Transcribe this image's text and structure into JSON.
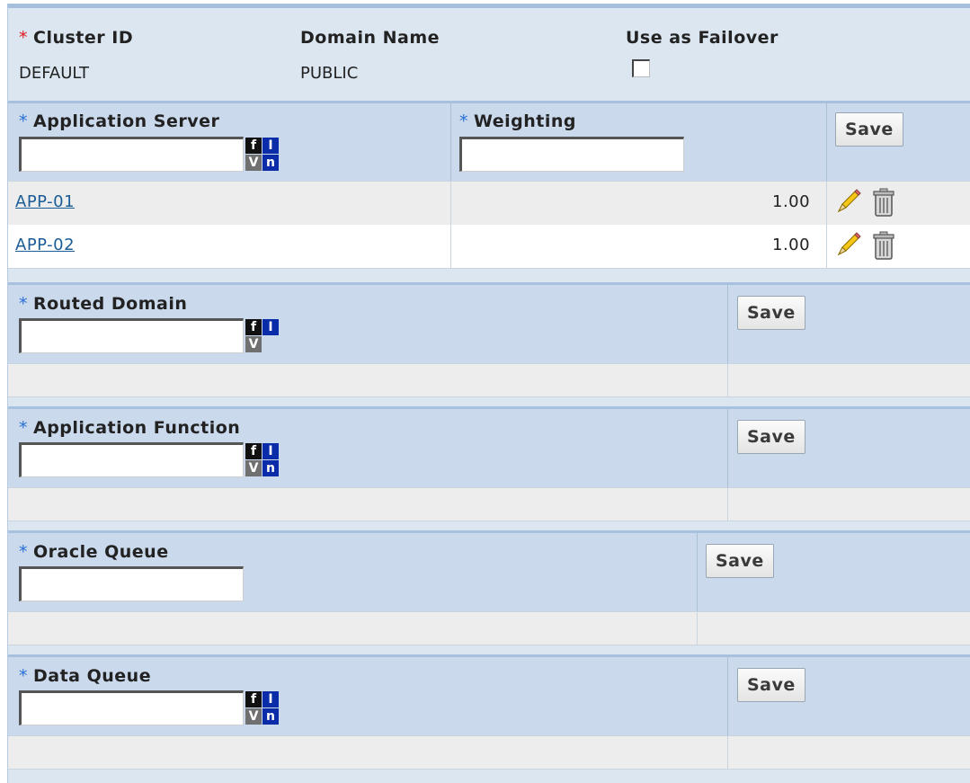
{
  "header": {
    "cluster_id_label": "Cluster ID",
    "cluster_id_value": "DEFAULT",
    "domain_name_label": "Domain Name",
    "domain_name_value": "PUBLIC",
    "failover_label": "Use as Failover",
    "failover_checked": false
  },
  "required_marker": "*",
  "save_label": "Save",
  "prompt_icons": {
    "f": "f",
    "i": "I",
    "v": "V",
    "n": "n"
  },
  "app_server": {
    "label": "Application Server",
    "input_value": "",
    "weighting_label": "Weighting",
    "weighting_value": "",
    "rows": [
      {
        "server": "APP-01",
        "weighting": "1.00"
      },
      {
        "server": "APP-02",
        "weighting": "1.00"
      }
    ]
  },
  "routed_domain": {
    "label": "Routed Domain",
    "input_value": ""
  },
  "app_function": {
    "label": "Application Function",
    "input_value": ""
  },
  "oracle_queue": {
    "label": "Oracle Queue",
    "input_value": ""
  },
  "data_queue": {
    "label": "Data Queue",
    "input_value": ""
  },
  "icons": {
    "edit": "pencil-icon",
    "delete": "trash-icon"
  },
  "colors": {
    "required_header": "#e01818",
    "required": "#2a6fd6",
    "link": "#1a5c96",
    "section_bg": "#cad9ec"
  }
}
